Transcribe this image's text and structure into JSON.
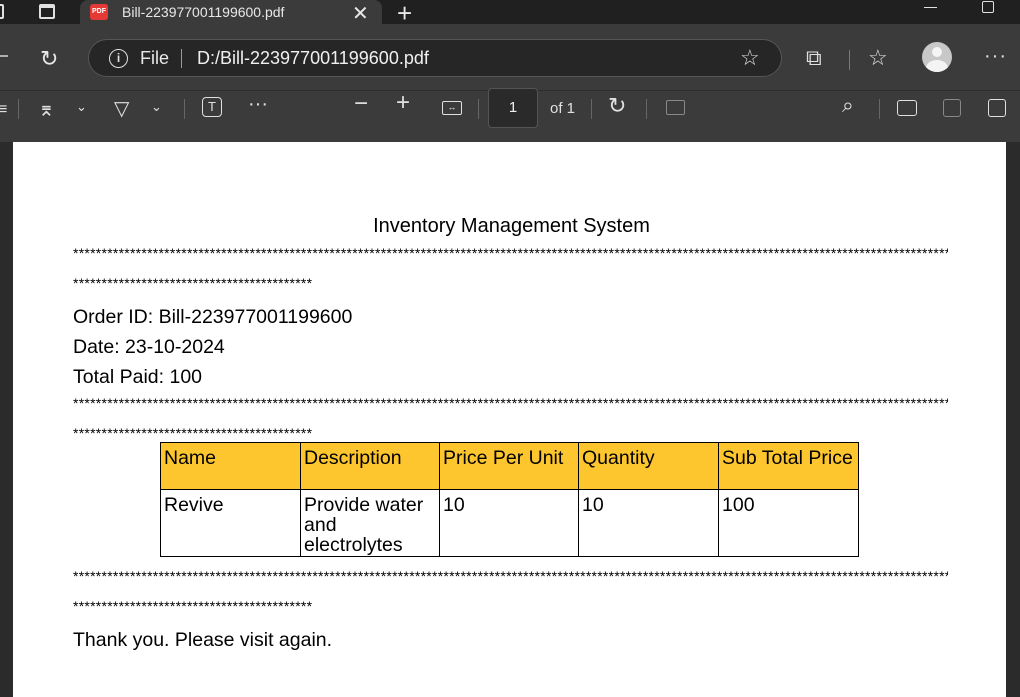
{
  "tab": {
    "title": "Bill-223977001199600.pdf",
    "badge": "PDF"
  },
  "address": {
    "scheme_label": "File",
    "url": "D:/Bill-223977001199600.pdf"
  },
  "pdf_toolbar": {
    "page_number": "1",
    "page_total": "of 1"
  },
  "document": {
    "title": "Inventory Management System",
    "stars_full": "**********************************************************************************************************************************************************************************",
    "stars_short": "******************************************",
    "order_id": "Order ID: Bill-223977001199600",
    "date": "Date: 23-10-2024",
    "total_paid": "Total Paid: 100",
    "table": {
      "headers": [
        "Name",
        "Description",
        "Price Per Unit",
        "Quantity",
        "Sub Total Price"
      ],
      "rows": [
        [
          "Revive",
          "Provide water and electrolytes",
          "10",
          "10",
          "100"
        ]
      ],
      "header_color": "#fdc62e"
    },
    "footer": "Thank you. Please visit again."
  },
  "icons": {
    "reload": "reload-icon",
    "info": "info-icon",
    "star": "favorite-star-icon",
    "extensions": "extensions-icon",
    "favorites": "favorites-icon",
    "more": "more-icon"
  }
}
